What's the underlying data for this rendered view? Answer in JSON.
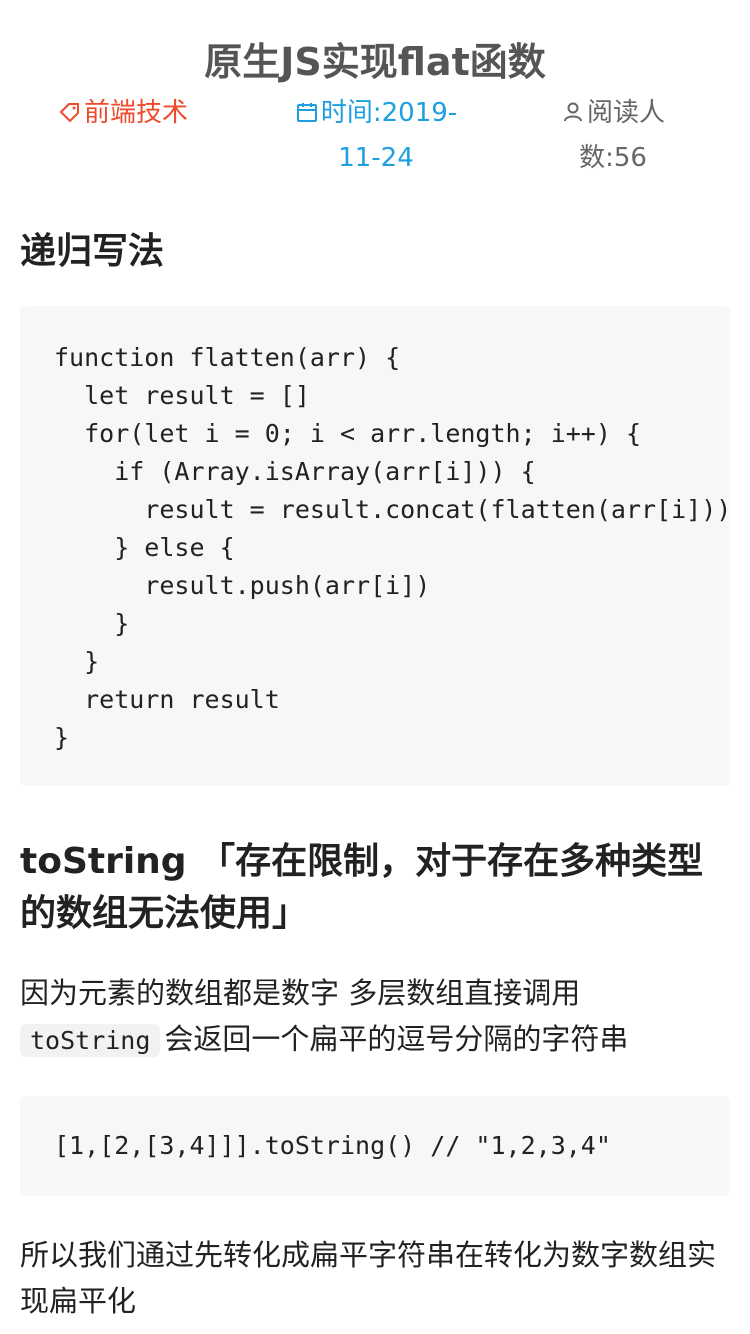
{
  "article": {
    "title": "原生JS实现flat函数",
    "meta": {
      "tag": "前端技术",
      "time_line1": "时间:2019-",
      "time_line2": "11-24",
      "reads_line1": "阅读人",
      "reads_line2": "数:56"
    },
    "sections": [
      {
        "heading": "递归写法",
        "code": [
          "function flatten(arr) {",
          "  let result = []",
          "  for(let i = 0; i < arr.length; i++) {",
          "    if (Array.isArray(arr[i])) {",
          "      result = result.concat(flatten(arr[i]))",
          "    } else {",
          "      result.push(arr[i])",
          "    }",
          "  }",
          "  return result",
          "}"
        ]
      },
      {
        "heading": "toString 「存在限制，对于存在多种类型的数组无法使用」",
        "para1_text_a": "因为元素的数组都是数字 多层数组直接调用",
        "para1_code": "toString",
        "para1_text_b": "会返回一个扁平的逗号分隔的字符串",
        "code": [
          "[1,[2,[3,4]]].toString() // \"1,2,3,4\""
        ],
        "para2": "所以我们通过先转化成扁平字符串在转化为数字数组实现扁平化"
      }
    ]
  },
  "icons": {
    "tag": "tag-icon",
    "time": "calendar-icon",
    "reads": "user-icon"
  },
  "colors": {
    "tag": "#ef4a2c",
    "time": "#1e9fe0",
    "reads": "#666666",
    "code_bg": "#f6f7f9"
  }
}
